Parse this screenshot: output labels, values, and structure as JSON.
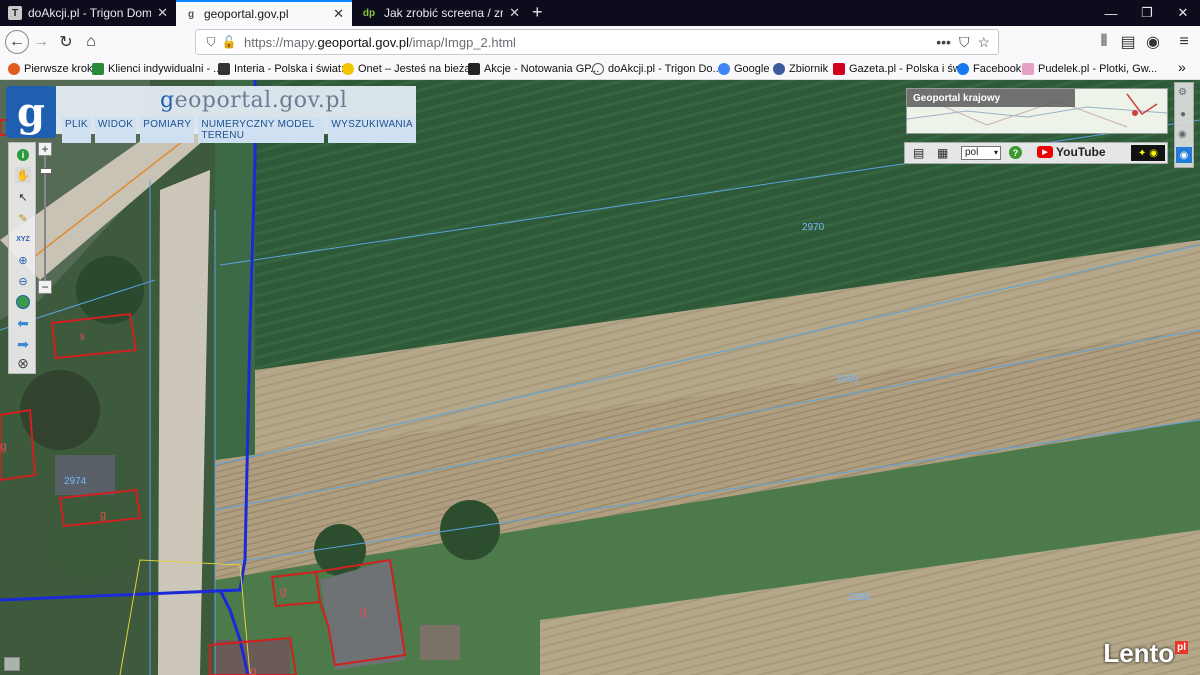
{
  "browser": {
    "tabs": [
      {
        "title": "doAkcji.pl - Trigon Dom Makle",
        "favicon": "T",
        "active": false
      },
      {
        "title": "geoportal.gov.pl",
        "favicon": "g",
        "active": true
      },
      {
        "title": "Jak zrobić screena / zrzut ekran",
        "favicon": "dp",
        "active": false
      }
    ],
    "new_tab": "+",
    "window_controls": [
      "—",
      "❐",
      "✕"
    ],
    "url_prefix": "https://mapy.",
    "url_domain": "geoportal.gov.pl",
    "url_path": "/imap/Imgp_2.html",
    "bookmarks": [
      {
        "label": "Pierwsze kroki",
        "color": "#e25c1e"
      },
      {
        "label": "Klienci indywidualni - ...",
        "color": "#2a8a3a"
      },
      {
        "label": "Interia - Polska i świat:...",
        "color": "#333333"
      },
      {
        "label": "Onet – Jesteś na bieżą...",
        "color": "#f5c400"
      },
      {
        "label": "Akcje - Notowania GP...",
        "color": "#222222"
      },
      {
        "label": "doAkcji.pl - Trigon Do...",
        "color": "#555555"
      },
      {
        "label": "Google",
        "color": "#4285f4"
      },
      {
        "label": "Zbiornik",
        "color": "#3b5b9a"
      },
      {
        "label": "Gazeta.pl - Polska i św...",
        "color": "#d0021b"
      },
      {
        "label": "Facebook",
        "color": "#1877f2"
      },
      {
        "label": "Pudelek.pl - Plotki, Gw...",
        "color": "#e6a2c6"
      }
    ],
    "bookmarks_overflow": "»"
  },
  "geoportal": {
    "logo_letter": "g",
    "brand_g": "g",
    "brand_rest": "eoportal.gov.pl",
    "menu": [
      "PLIK",
      "WIDOK",
      "POMIARY",
      "NUMERYCZNY MODEL TERENU",
      "WYSZUKIWANIA"
    ],
    "overview_title": "Geoportal krajowy",
    "language": "pol",
    "youtube_label": "YouTube",
    "zoom_in": "+",
    "zoom_out": "−"
  },
  "parcels": [
    "2970",
    "2969",
    "2974",
    "2968"
  ],
  "watermark": {
    "text": "Lento",
    "suffix": "pl"
  }
}
